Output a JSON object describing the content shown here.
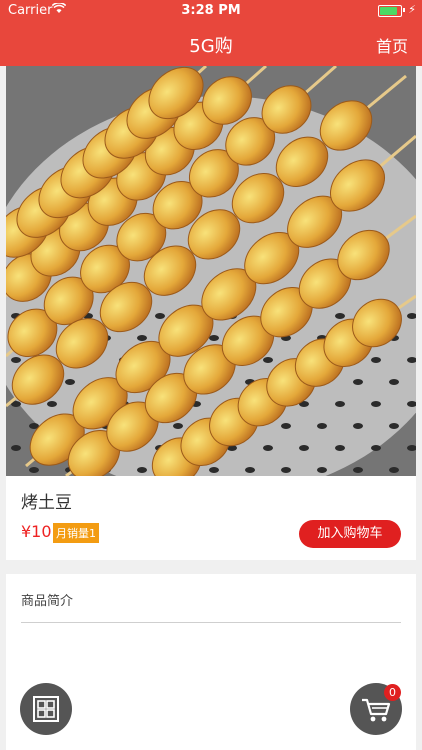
{
  "status_bar": {
    "carrier": "Carrier",
    "time": "3:28 PM",
    "battery_level": 0.92,
    "wifi_icon": "wifi-icon",
    "charging_icon": "bolt-icon"
  },
  "navbar": {
    "title": "5G购",
    "home_label": "首页"
  },
  "colors": {
    "brand": "#e8473c",
    "button": "#e02020",
    "badge_orange": "#f39c12",
    "battery": "#4cd964"
  },
  "product": {
    "name": "烤土豆",
    "price": "¥10",
    "sales": "月销量1",
    "add_to_cart": "加入购物车"
  },
  "description": {
    "title": "商品简介"
  },
  "fab": {
    "grid_icon": "grid-icon",
    "cart_icon": "cart-icon",
    "cart_count": "0"
  }
}
